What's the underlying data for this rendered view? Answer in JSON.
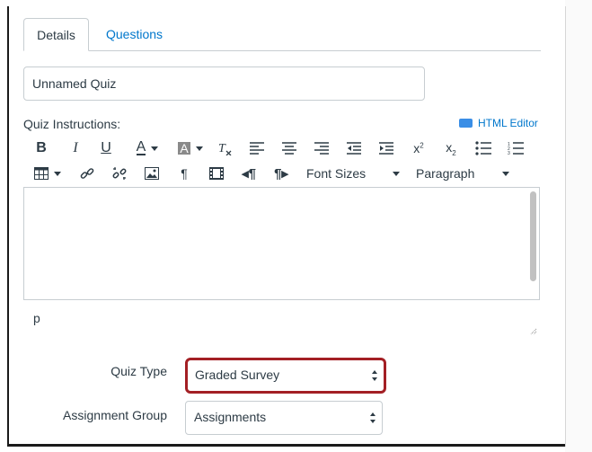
{
  "tabs": {
    "details": "Details",
    "questions": "Questions"
  },
  "quiz": {
    "title_value": "Unnamed Quiz",
    "instructions_label": "Quiz Instructions:",
    "html_editor_label": "HTML Editor"
  },
  "toolbar": {
    "font_sizes_label": "Font Sizes",
    "paragraph_label": "Paragraph",
    "items": [
      "bold",
      "italic",
      "underline",
      "text-color",
      "background-color",
      "clear-formatting",
      "align-left",
      "align-center",
      "align-right",
      "outdent",
      "indent",
      "superscript",
      "subscript",
      "bullet-list",
      "numbered-list",
      "table",
      "link",
      "unlink",
      "image",
      "show-blocks",
      "media",
      "ltr",
      "rtl"
    ]
  },
  "editor": {
    "status_path": "p"
  },
  "form": {
    "quiz_type_label": "Quiz Type",
    "quiz_type_value": "Graded Survey",
    "assignment_group_label": "Assignment Group",
    "assignment_group_value": "Assignments"
  },
  "colors": {
    "link": "#0077cc",
    "highlight_border": "#a31f24",
    "text": "#2d3b45",
    "border": "#c7cdd1"
  }
}
